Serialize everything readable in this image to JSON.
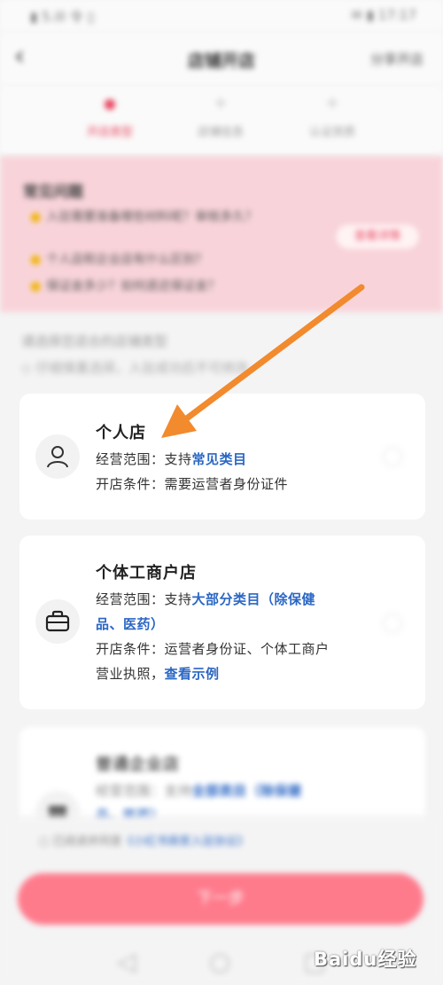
{
  "status_bar": {
    "left": "▮ 5.ill 令 ▯",
    "right": "✉ ▮ 17:17"
  },
  "nav": {
    "back_icon": "back-chevron-icon",
    "title": "店铺开店",
    "right_link": "分享开店"
  },
  "steps": [
    {
      "label": "开店类型",
      "active": true
    },
    {
      "label": "店铺信息",
      "active": false
    },
    {
      "label": "认证资质",
      "active": false
    }
  ],
  "notice": {
    "title": "常见问题",
    "items": [
      "入驻需要准备哪些材料呢？审核多久？",
      "个人店和企业店有什么区别？",
      "保证金多少？如何退还保证金？"
    ],
    "button": "查看详情"
  },
  "hints": {
    "line1": "请选择您适合的店铺类型",
    "line2": "◇ 仔细慎重选择，入驻成功后不可修改"
  },
  "cards": [
    {
      "title": "个人店",
      "scope_prefix": "经营范围：支持",
      "scope_highlight": "常见类目",
      "scope_suffix": "",
      "scope_cont": "",
      "condition_prefix": "开店条件：需要运营者身份证件",
      "condition_cont": "",
      "condition_link": ""
    },
    {
      "title": "个体工商户店",
      "scope_prefix": "经营范围：支持",
      "scope_highlight": "大部分类目（除保健",
      "scope_cont": "品、医药）",
      "condition_prefix": "开店条件：运营者身份证、个体工商户",
      "condition_cont": "营业执照，",
      "condition_link": "查看示例"
    },
    {
      "title": "普通企业店",
      "scope_prefix": "经营范围：支持",
      "scope_highlight": "全部类目（除保健",
      "scope_cont": "品、医药）"
    }
  ],
  "agreement": {
    "text": "已阅读并同意",
    "link": "《小红书商家入驻协议》"
  },
  "main_button": "下一步",
  "watermark": {
    "text": "Baidu经验"
  },
  "colors": {
    "accent": "#e8455f",
    "link": "#2b67c4",
    "button": "#fe7b8c",
    "arrow": "#f28a2e"
  }
}
